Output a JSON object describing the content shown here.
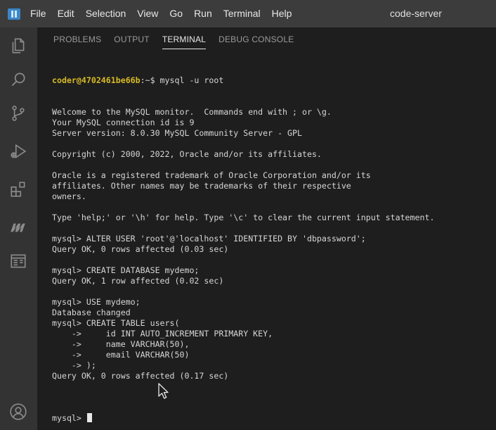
{
  "titlebar": {
    "menu": [
      "File",
      "Edit",
      "Selection",
      "View",
      "Go",
      "Run",
      "Terminal",
      "Help"
    ],
    "window_title": "code-server"
  },
  "activitybar": {
    "icons": [
      "files-icon",
      "search-icon",
      "source-control-icon",
      "run-debug-icon",
      "extensions-icon",
      "remote-explorer-icon",
      "panel-icon",
      "account-icon"
    ]
  },
  "panel": {
    "tabs": [
      "PROBLEMS",
      "OUTPUT",
      "TERMINAL",
      "DEBUG CONSOLE"
    ],
    "active_tab": "TERMINAL"
  },
  "terminal": {
    "prompt_user": "coder@4702461be66b",
    "prompt_rest": ":~$ mysql -u root",
    "lines": [
      "Welcome to the MySQL monitor.  Commands end with ; or \\g.",
      "Your MySQL connection id is 9",
      "Server version: 8.0.30 MySQL Community Server - GPL",
      "",
      "Copyright (c) 2000, 2022, Oracle and/or its affiliates.",
      "",
      "Oracle is a registered trademark of Oracle Corporation and/or its",
      "affiliates. Other names may be trademarks of their respective",
      "owners.",
      "",
      "Type 'help;' or '\\h' for help. Type '\\c' to clear the current input statement.",
      "",
      "mysql> ALTER USER 'root'@'localhost' IDENTIFIED BY 'dbpassword';",
      "Query OK, 0 rows affected (0.03 sec)",
      "",
      "mysql> CREATE DATABASE mydemo;",
      "Query OK, 1 row affected (0.02 sec)",
      "",
      "mysql> USE mydemo;",
      "Database changed",
      "mysql> CREATE TABLE users(",
      "    ->     id INT AUTO_INCREMENT PRIMARY KEY,",
      "    ->     name VARCHAR(50),",
      "    ->     email VARCHAR(50)",
      "    -> );",
      "Query OK, 0 rows affected (0.17 sec)",
      ""
    ],
    "current_prompt": "mysql> "
  },
  "colors": {
    "titlebar_bg": "#3c3c3c",
    "activitybar_bg": "#333333",
    "panel_bg": "#1e1e1e",
    "prompt_user": "#d7ba26",
    "text": "#d6d6d6"
  }
}
